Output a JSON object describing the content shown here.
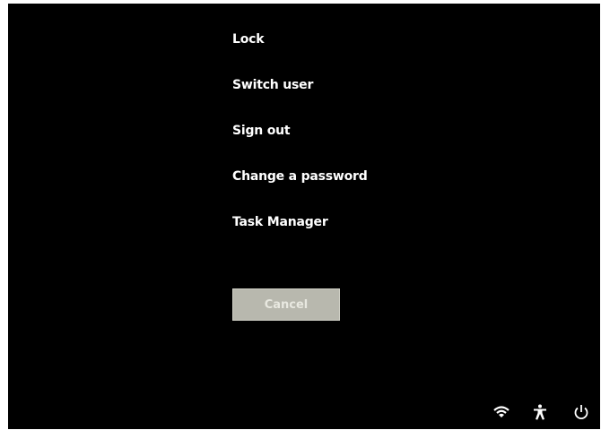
{
  "menu": {
    "items": [
      {
        "label": "Lock"
      },
      {
        "label": "Switch user"
      },
      {
        "label": "Sign out"
      },
      {
        "label": "Change a password"
      },
      {
        "label": "Task Manager"
      }
    ]
  },
  "cancel_button": {
    "label": "Cancel"
  },
  "tray": {
    "icons": [
      "wifi-icon",
      "accessibility-icon",
      "power-icon"
    ]
  },
  "colors": {
    "background": "#000000",
    "text": "#ffffff",
    "button": "#b8b8ae"
  }
}
